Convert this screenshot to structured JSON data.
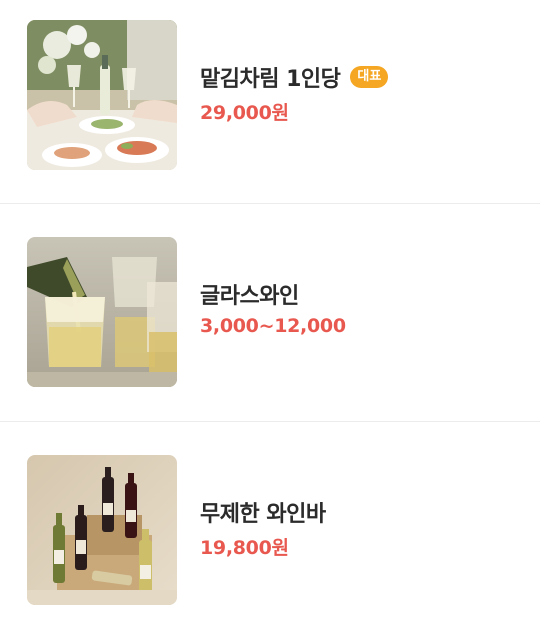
{
  "menu": {
    "items": [
      {
        "name": "맡김차림 1인당",
        "badge": "대표",
        "price": "29,000원",
        "image_icon": "dining-table-wine-photo"
      },
      {
        "name": "글라스와인",
        "price": "3,000~12,000",
        "image_icon": "sparkling-wine-glasses-photo"
      },
      {
        "name": "무제한 와인바",
        "price": "19,800원",
        "image_icon": "wine-bottles-photo"
      }
    ]
  },
  "colors": {
    "price": "#e8584f",
    "badge": "#f5a623",
    "name": "#2b2b2b",
    "divider": "#ececec"
  }
}
